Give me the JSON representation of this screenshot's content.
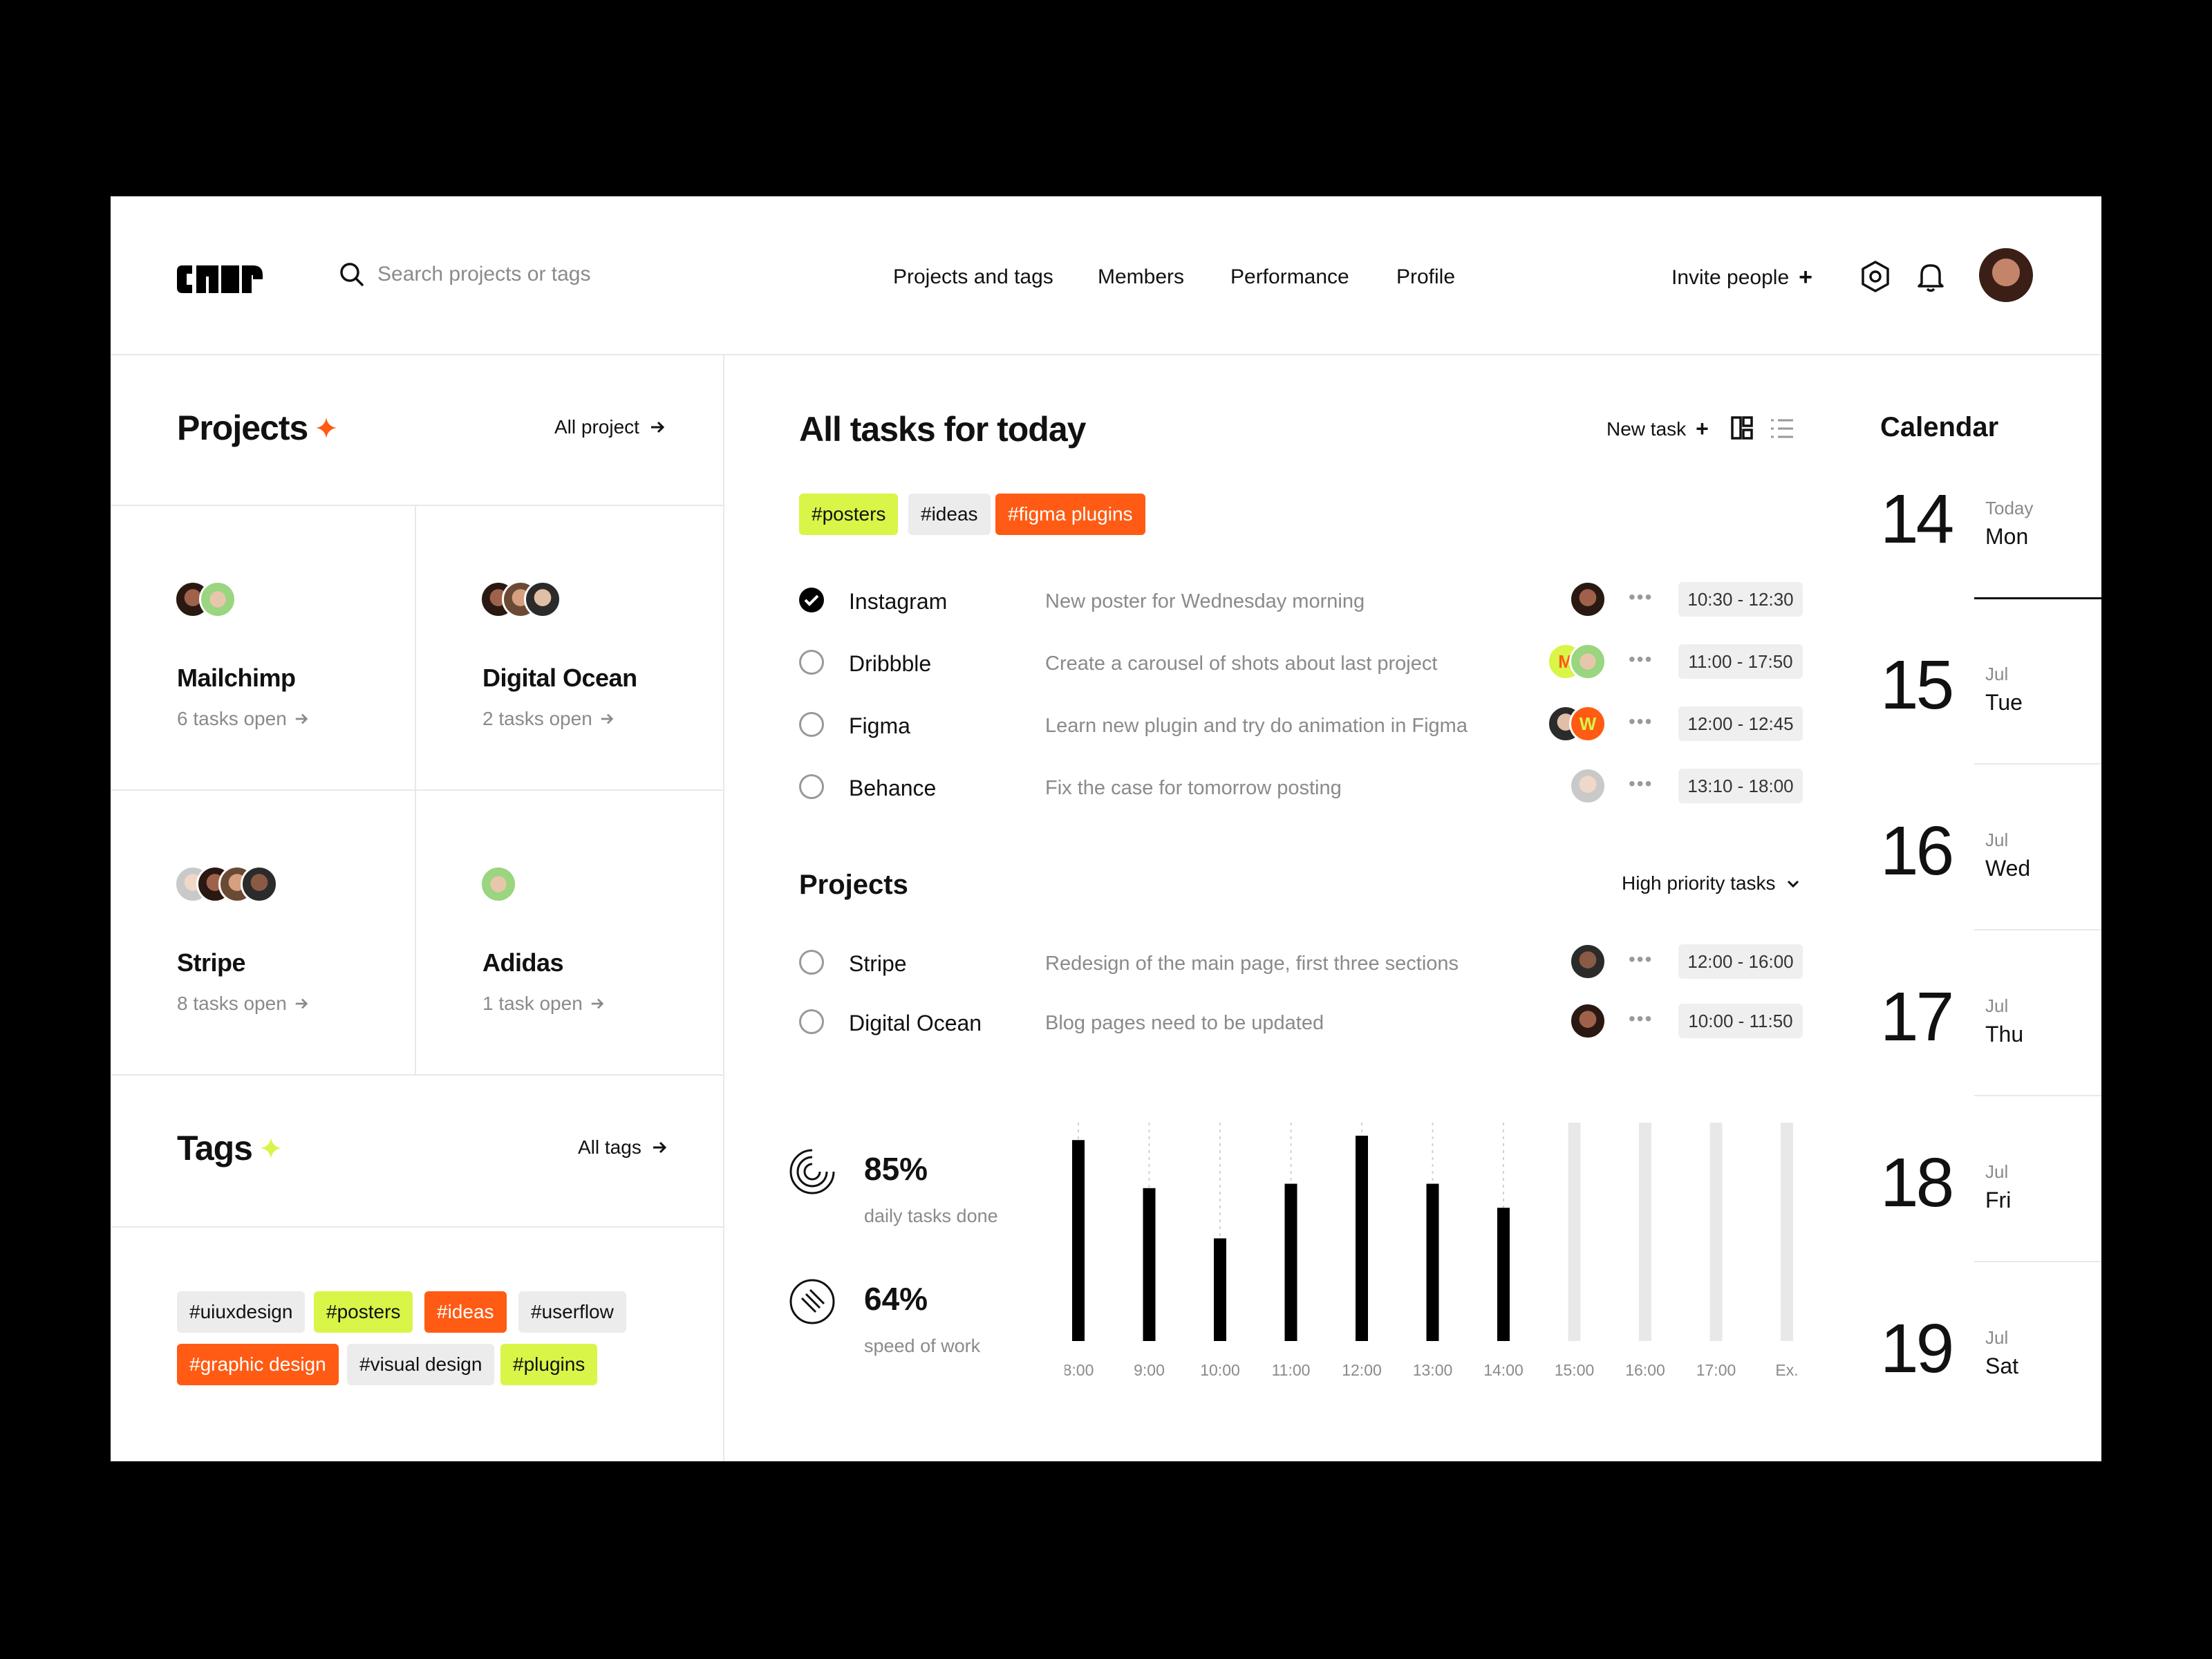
{
  "header": {
    "logo_text": "cmr",
    "search_placeholder": "Search projects or tags",
    "nav": [
      "Projects and tags",
      "Members",
      "Performance",
      "Profile"
    ],
    "invite_label": "Invite people",
    "plus": "+"
  },
  "projects_panel": {
    "title": "Projects",
    "all_link": "All project",
    "cards": [
      {
        "name": "Mailchimp",
        "count": "6 tasks open"
      },
      {
        "name": "Digital Ocean",
        "count": "2 tasks open"
      },
      {
        "name": "Stripe",
        "count": "8 tasks open"
      },
      {
        "name": "Adidas",
        "count": "1 task open"
      }
    ]
  },
  "tags_panel": {
    "title": "Tags",
    "all_link": "All tags",
    "tags": [
      "#uiuxdesign",
      "#posters",
      "#ideas",
      "#userflow",
      "#graphic design",
      "#visual design",
      "#plugins"
    ]
  },
  "tasks": {
    "title": "All tasks for today",
    "new_task": "New task",
    "filter_tags": [
      "#posters",
      "#ideas",
      "#figma plugins"
    ],
    "rows": [
      {
        "name": "Instagram",
        "desc": "New poster for Wednesday morning",
        "time": "10:30 - 12:30",
        "done": true
      },
      {
        "name": "Dribbble",
        "desc": "Create a carousel of shots about last project",
        "time": "11:00 - 17:50",
        "done": false
      },
      {
        "name": "Figma",
        "desc": "Learn new plugin and try do animation in Figma",
        "time": "12:00 - 12:45",
        "done": false
      },
      {
        "name": "Behance",
        "desc": "Fix the case for tomorrow posting",
        "time": "13:10 - 18:00",
        "done": false
      }
    ],
    "avatar_letters": [
      "M",
      "W"
    ],
    "more": "•••"
  },
  "priority": {
    "title": "Projects",
    "dropdown": "High priority tasks",
    "rows": [
      {
        "name": "Stripe",
        "desc": "Redesign of the main page, first three sections",
        "time": "12:00 - 16:00"
      },
      {
        "name": "Digital Ocean",
        "desc": "Blog pages need to be updated",
        "time": "10:00 - 11:50"
      }
    ]
  },
  "stats": [
    {
      "value": "85%",
      "label": "daily tasks done"
    },
    {
      "value": "64%",
      "label": "speed of work"
    }
  ],
  "chart_data": {
    "type": "bar",
    "categories": [
      "8:00",
      "9:00",
      "10:00",
      "11:00",
      "12:00",
      "13:00",
      "14:00",
      "15:00",
      "16:00",
      "17:00",
      "Ex."
    ],
    "values": [
      0.92,
      0.7,
      0.47,
      0.72,
      0.94,
      0.72,
      0.61,
      1.0,
      1.0,
      1.0,
      1.0
    ],
    "future_from_index": 7,
    "colors": {
      "bar": "#000000",
      "future": "#e8e8e8"
    }
  },
  "calendar": {
    "title": "Calendar",
    "days": [
      {
        "day": "14",
        "month": "Today",
        "weekday": "Mon"
      },
      {
        "day": "15",
        "month": "Jul",
        "weekday": "Tue"
      },
      {
        "day": "16",
        "month": "Jul",
        "weekday": "Wed"
      },
      {
        "day": "17",
        "month": "Jul",
        "weekday": "Thu"
      },
      {
        "day": "18",
        "month": "Jul",
        "weekday": "Fri"
      },
      {
        "day": "19",
        "month": "Jul",
        "weekday": "Sat"
      }
    ]
  },
  "colors": {
    "accent_orange": "#ff5b14",
    "accent_lime": "#d8f548"
  }
}
